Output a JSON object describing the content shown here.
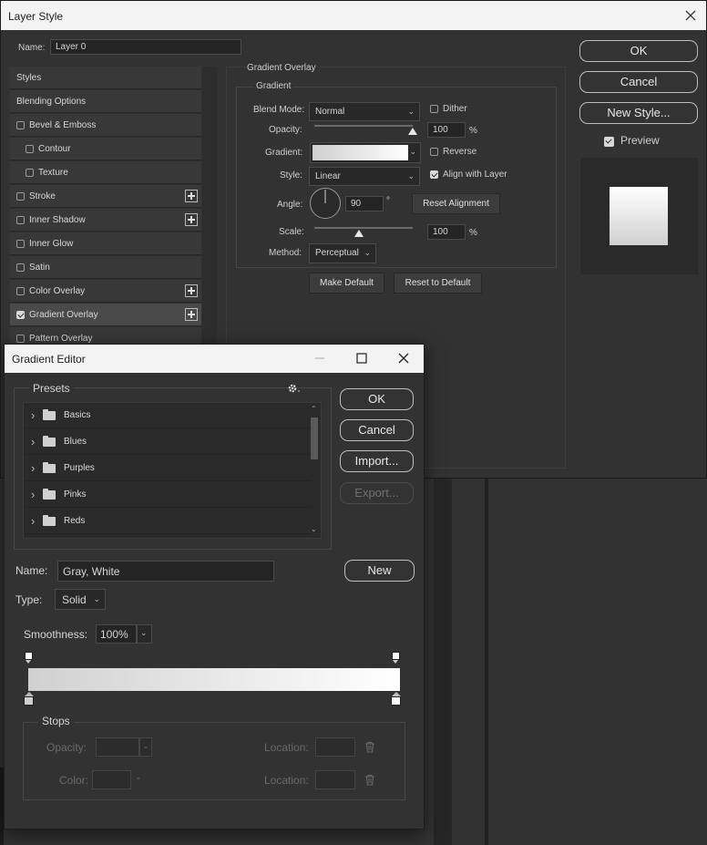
{
  "layer_style": {
    "title": "Layer Style",
    "name_label": "Name:",
    "name_value": "Layer 0",
    "buttons": {
      "ok": "OK",
      "cancel": "Cancel",
      "new_style": "New Style...",
      "preview": "Preview"
    },
    "styles": [
      {
        "label": "Styles",
        "checkbox": false,
        "checked": false,
        "plus": false,
        "indent": false
      },
      {
        "label": "Blending Options",
        "checkbox": false,
        "checked": false,
        "plus": false,
        "indent": false
      },
      {
        "label": "Bevel & Emboss",
        "checkbox": true,
        "checked": false,
        "plus": false,
        "indent": false
      },
      {
        "label": "Contour",
        "checkbox": true,
        "checked": false,
        "plus": false,
        "indent": true
      },
      {
        "label": "Texture",
        "checkbox": true,
        "checked": false,
        "plus": false,
        "indent": true
      },
      {
        "label": "Stroke",
        "checkbox": true,
        "checked": false,
        "plus": true,
        "indent": false
      },
      {
        "label": "Inner Shadow",
        "checkbox": true,
        "checked": false,
        "plus": true,
        "indent": false
      },
      {
        "label": "Inner Glow",
        "checkbox": true,
        "checked": false,
        "plus": false,
        "indent": false
      },
      {
        "label": "Satin",
        "checkbox": true,
        "checked": false,
        "plus": false,
        "indent": false
      },
      {
        "label": "Color Overlay",
        "checkbox": true,
        "checked": false,
        "plus": true,
        "indent": false
      },
      {
        "label": "Gradient Overlay",
        "checkbox": true,
        "checked": true,
        "plus": true,
        "indent": false,
        "selected": true
      },
      {
        "label": "Pattern Overlay",
        "checkbox": true,
        "checked": false,
        "plus": false,
        "indent": false
      }
    ],
    "overlay": {
      "section_title": "Gradient Overlay",
      "group_title": "Gradient",
      "blend_mode_label": "Blend Mode:",
      "blend_mode": "Normal",
      "dither_label": "Dither",
      "opacity_label": "Opacity:",
      "opacity": "100",
      "percent": "%",
      "opacity_level": 1.0,
      "gradient_label": "Gradient:",
      "reverse_label": "Reverse",
      "style_label": "Style:",
      "style": "Linear",
      "align_label": "Align with Layer",
      "angle_label": "Angle:",
      "angle": "90",
      "degree": "°",
      "reset_alignment": "Reset Alignment",
      "scale_label": "Scale:",
      "scale": "100",
      "scale_level": 0.45,
      "method_label": "Method:",
      "method": "Perceptual",
      "make_default": "Make Default",
      "reset_default": "Reset to Default"
    }
  },
  "gradient_editor": {
    "title": "Gradient Editor",
    "presets_label": "Presets",
    "presets": [
      "Basics",
      "Blues",
      "Purples",
      "Pinks",
      "Reds"
    ],
    "buttons": {
      "ok": "OK",
      "cancel": "Cancel",
      "import": "Import...",
      "export": "Export...",
      "new": "New"
    },
    "name_label": "Name:",
    "name_value": "Gray, White",
    "type_label": "Type:",
    "type_value": "Solid",
    "smoothness_label": "Smoothness:",
    "smoothness_value": "100%",
    "stops_label": "Stops",
    "opacity_label": "Opacity:",
    "color_label": "Color:",
    "location_label": "Location:",
    "gradient_colors": [
      "#d0d0d0",
      "#ffffff"
    ]
  }
}
